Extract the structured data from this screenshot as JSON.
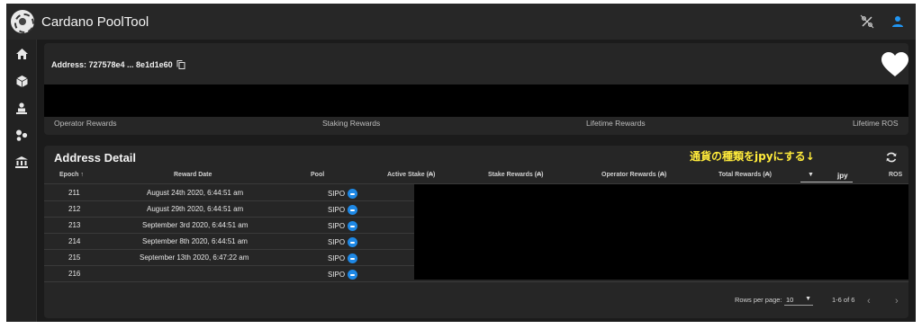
{
  "app": {
    "title": "Cardano PoolTool"
  },
  "topbar": {
    "icons": [
      "percent-slash-icon",
      "user-icon"
    ],
    "accent": "#2196f3"
  },
  "sidebar": {
    "icons": [
      "home-icon",
      "cube-icon",
      "staking-icon",
      "pools-icon",
      "bank-icon"
    ]
  },
  "address": {
    "label": "Address: 727578e4 ... 8e1d1e60",
    "reward_labels": [
      "Operator Rewards",
      "Staking Rewards",
      "Lifetime Rewards",
      "Lifetime ROS"
    ]
  },
  "detail": {
    "title": "Address Detail",
    "annotation": "通貨の種類をjpyにする↓",
    "headers": {
      "epoch": "Epoch ↑",
      "reward_date": "Reward Date",
      "pool": "Pool",
      "active_stake": "Active Stake (₳)",
      "stake_rewards": "Stake Rewards (₳)",
      "operator_rewards": "Operator Rewards (₳)",
      "total_rewards": "Total Rewards (₳)",
      "ros": "ROS"
    },
    "currency": {
      "caret": "▼",
      "value": "jpy"
    },
    "rows": [
      {
        "epoch": "211",
        "date": "August 24th 2020, 6:44:51 am",
        "pool": "SIPO"
      },
      {
        "epoch": "212",
        "date": "August 29th 2020, 6:44:51 am",
        "pool": "SIPO"
      },
      {
        "epoch": "213",
        "date": "September 3rd 2020, 6:44:51 am",
        "pool": "SIPO"
      },
      {
        "epoch": "214",
        "date": "September 8th 2020, 6:44:51 am",
        "pool": "SIPO"
      },
      {
        "epoch": "215",
        "date": "September 13th 2020, 6:47:22 am",
        "pool": "SIPO"
      },
      {
        "epoch": "216",
        "date": "",
        "pool": "SIPO"
      }
    ]
  },
  "footer": {
    "rows_per_page_label": "Rows per page:",
    "rows_per_page_value": "10",
    "rows_per_page_caret": "▼",
    "range": "1-6 of 6",
    "prev": "‹",
    "next": "›"
  }
}
